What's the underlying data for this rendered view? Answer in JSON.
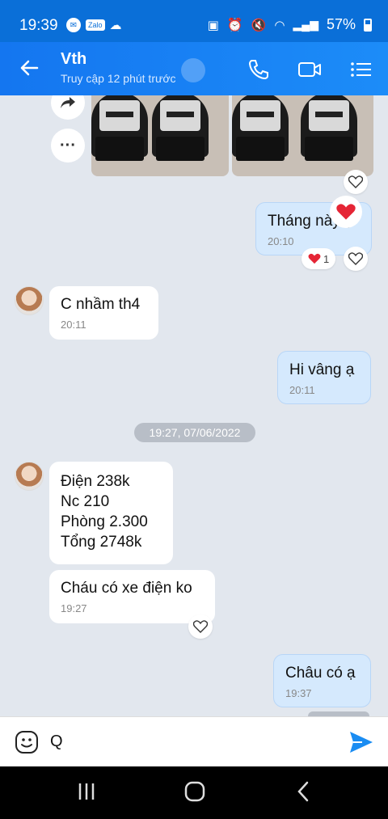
{
  "status": {
    "time": "19:39",
    "left_icons": [
      "messenger-icon",
      "zalo-icon",
      "weather-icon"
    ],
    "right_icons": [
      "battery-saver-icon",
      "alarm-icon",
      "mute-icon",
      "wifi-icon",
      "signal-icon"
    ],
    "battery": "57%"
  },
  "header": {
    "contact_name": "Vth",
    "last_seen": "Truy cập 12 phút trước"
  },
  "messages": {
    "m1": {
      "text": "Tháng này ạ",
      "time": "20:10",
      "reaction_count": "1"
    },
    "m2": {
      "text": "C nhầm th4",
      "time": "20:11"
    },
    "m3": {
      "text": "Hi vâng ạ",
      "time": "20:11"
    },
    "date_separator": "19:27, 07/06/2022",
    "m4": {
      "lines": [
        "Điện 238k",
        "Nc 210",
        "Phòng 2.300",
        "Tổng 2748k"
      ]
    },
    "m5": {
      "text": "Cháu có xe điện ko",
      "time": "19:27"
    },
    "m6": {
      "text": "Châu có ạ",
      "time": "19:37"
    }
  },
  "input": {
    "value": "Q"
  },
  "colors": {
    "header": "#1476f0",
    "outgoing_bubble": "#d5e9fd",
    "chat_bg": "#e2e7ee",
    "send": "#1a8cf2"
  }
}
